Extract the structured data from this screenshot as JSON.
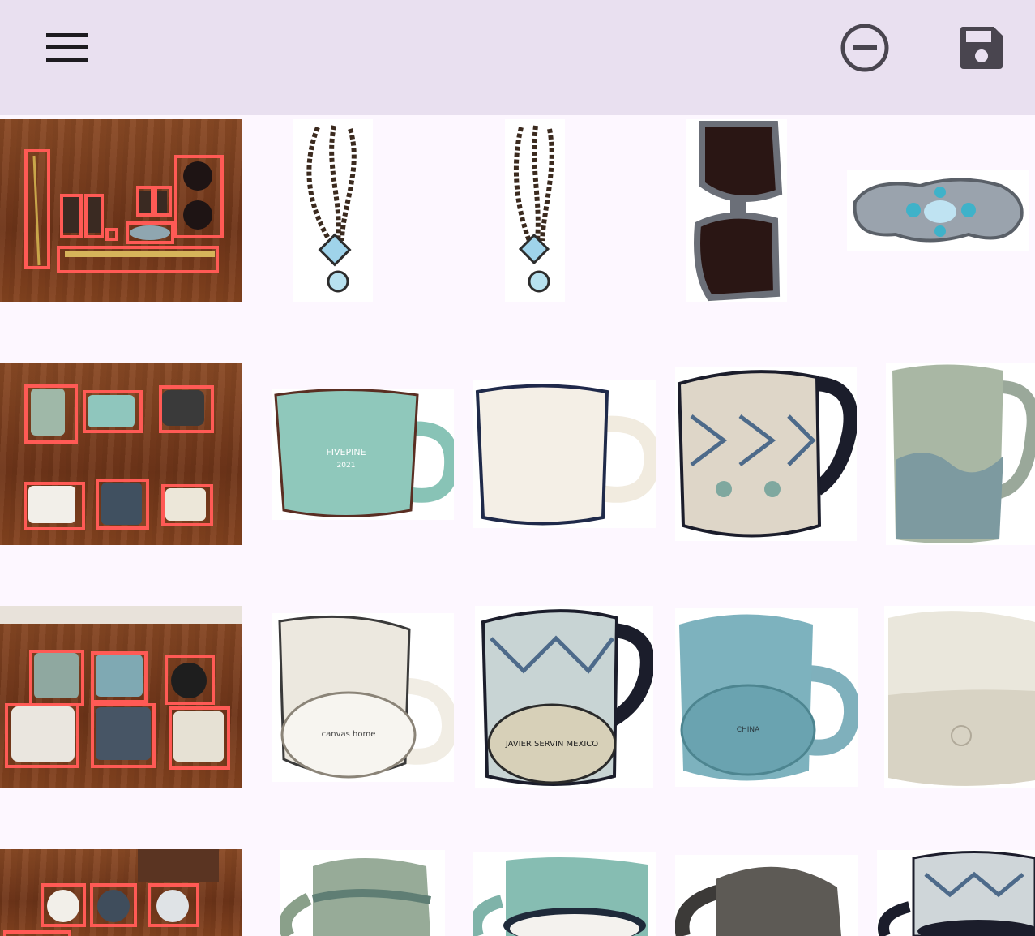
{
  "toolbar": {
    "menu_icon": "menu-icon",
    "remove_icon": "minus-circle-icon",
    "save_icon": "floppy-disk-icon",
    "background": "#e9e0f0"
  },
  "colors": {
    "bbox": "#ff5a55",
    "page_background": "#fdf7ff"
  },
  "rows": [
    {
      "scene": "jewelry-scene",
      "items": [
        "chain-necklace",
        "chain-necklace",
        "sunglasses",
        "beaded-brooch"
      ]
    },
    {
      "scene": "mugs-scene",
      "items": [
        "teal-camp-mug",
        "white-enamel-mug",
        "patterned-pitcher-mug",
        "glazed-ceramic-mug"
      ]
    },
    {
      "scene": "mugs-bottom-scene",
      "items": [
        "white-mug-bottom",
        "patterned-mug-bottom",
        "teal-mug-bottom",
        "speckled-mug-bottom"
      ]
    },
    {
      "scene": "mugs-top-scene",
      "items": [
        "green-glaze-mug",
        "teal-mug",
        "dark-gray-mug",
        "patterned-mug"
      ]
    }
  ],
  "imprints": {
    "teal_mug_brand": "FIVEPINE",
    "teal_mug_year": "2021",
    "white_mug_base": "canvas home",
    "patterned_mug_base": "JAVIER SERVIN MEXICO",
    "teal_mug_base": "CHINA"
  }
}
